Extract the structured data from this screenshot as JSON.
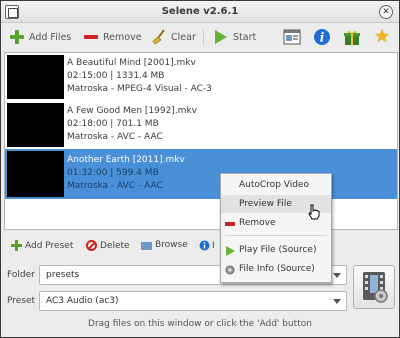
{
  "window": {
    "title": "Selene v2.6.1"
  },
  "toolbar": {
    "add_files_label": "Add Files",
    "remove_label": "Remove",
    "clear_label": "Clear",
    "start_label": "Start",
    "info_glyph": "i",
    "star_glyph": "★"
  },
  "files": [
    {
      "name": "A Beautiful Mind [2001].mkv",
      "duration_size": "02:15:00 | 1331.4 MB",
      "format": "Matroska - MPEG-4 Visual - AC-3"
    },
    {
      "name": "A Few Good Men [1992].mkv",
      "duration_size": "02:18:00 | 701.1 MB",
      "format": "Matroska - AVC - AAC"
    },
    {
      "name": "Another Earth [2011].mkv",
      "duration_size": "01:32:00 | 599.4 MB",
      "format": "Matroska - AVC - AAC"
    }
  ],
  "preset_toolbar": {
    "add_preset_label": "Add Preset",
    "delete_label": "Delete",
    "browse_label": "Browse",
    "info_label": "I"
  },
  "form": {
    "folder_label": "Folder",
    "folder_value": "presets",
    "preset_label": "Preset",
    "preset_value": "AC3 Audio (ac3)"
  },
  "context_menu": {
    "autocrop_label": "AutoCrop Video",
    "preview_label": "Preview File",
    "remove_label": "Remove",
    "play_label": "Play File (Source)",
    "info_label": "File Info (Source)"
  },
  "status": {
    "text": "Drag files on this window or click the 'Add' button"
  },
  "colors": {
    "selection": "#4a90d9",
    "add_green": "#5aa02c",
    "remove_red": "#cc2222",
    "info_blue": "#1f6fd0"
  }
}
